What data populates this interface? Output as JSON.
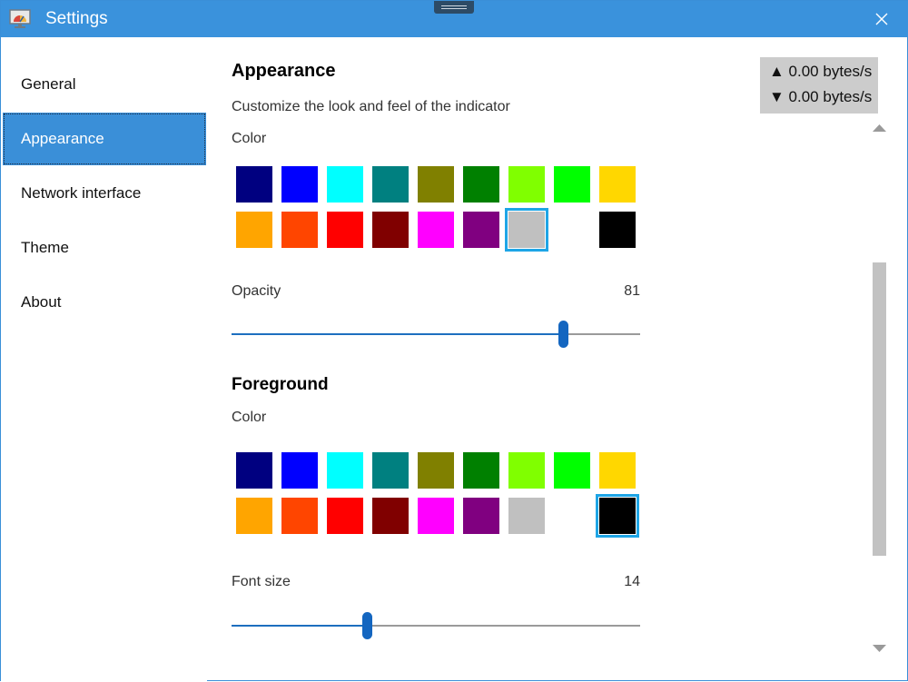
{
  "window": {
    "title": "Settings"
  },
  "sidebar": {
    "items": [
      {
        "label": "General",
        "active": false
      },
      {
        "label": "Appearance",
        "active": true
      },
      {
        "label": "Network interface",
        "active": false
      },
      {
        "label": "Theme",
        "active": false
      },
      {
        "label": "About",
        "active": false
      }
    ]
  },
  "appearance": {
    "title": "Appearance",
    "description": "Customize the look and feel of the indicator",
    "background_color_label": "Color",
    "background_selected": "#C0C0C0",
    "opacity_label": "Opacity",
    "opacity_value": "81",
    "opacity_fraction": 0.81,
    "foreground_title": "Foreground",
    "foreground_color_label": "Color",
    "foreground_selected": "#000000",
    "font_size_label": "Font size",
    "font_size_value": "14",
    "font_size_fraction": 0.33
  },
  "palette": [
    "#000080",
    "#0000FF",
    "#00FFFF",
    "#008080",
    "#808000",
    "#008000",
    "#80FF00",
    "#00FF00",
    "#FFD700",
    "#FFA500",
    "#FF4500",
    "#FF0000",
    "#800000",
    "#FF00FF",
    "#800080",
    "#C0C0C0",
    "#FFFFFF",
    "#000000"
  ],
  "speed": {
    "upload": "▲ 0.00 bytes/s",
    "download": "▼ 0.00 bytes/s"
  },
  "colors": {
    "titlebar": "#3A92DC",
    "accent": "#3A8FD8",
    "selection_border": "#1EA5E6"
  }
}
